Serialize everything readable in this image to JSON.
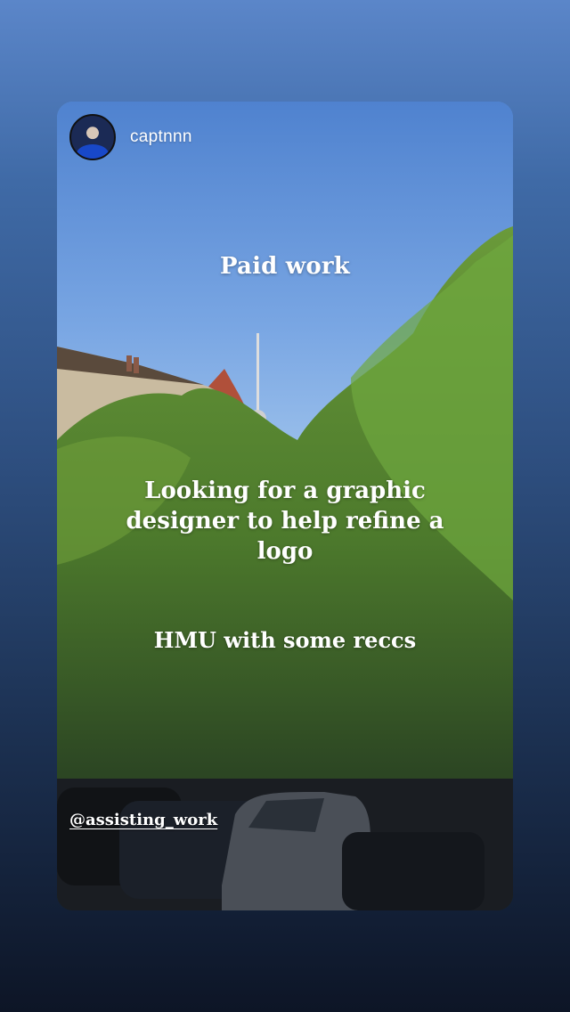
{
  "story": {
    "username": "captnnn",
    "title": "Paid work",
    "body_text": "Looking for a graphic designer to help refine a logo",
    "cta_text": "HMU with some reccs",
    "mention": "@assisting_work"
  },
  "icons": {
    "avatar": "profile-avatar"
  },
  "colors": {
    "background_top": "#5b86c9",
    "background_bottom": "#0d1526",
    "text": "#ffffff"
  }
}
